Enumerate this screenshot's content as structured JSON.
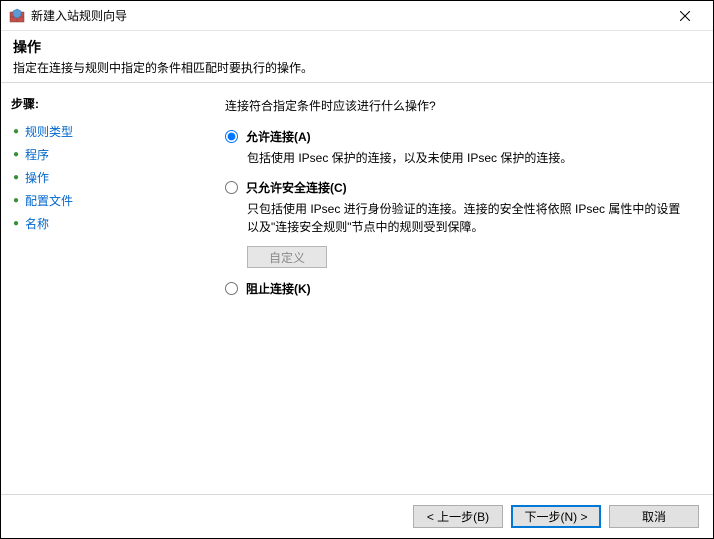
{
  "titlebar": {
    "title": "新建入站规则向导"
  },
  "header": {
    "title": "操作",
    "desc": "指定在连接与规则中指定的条件相匹配时要执行的操作。"
  },
  "sidebar": {
    "steps_label": "步骤:",
    "items": [
      {
        "label": "规则类型"
      },
      {
        "label": "程序"
      },
      {
        "label": "操作"
      },
      {
        "label": "配置文件"
      },
      {
        "label": "名称"
      }
    ]
  },
  "content": {
    "question": "连接符合指定条件时应该进行什么操作?",
    "options": [
      {
        "id": "allow",
        "label": "允许连接(A)",
        "desc": "包括使用 IPsec 保护的连接，以及未使用 IPsec 保护的连接。",
        "checked": true
      },
      {
        "id": "allow_secure",
        "label": "只允许安全连接(C)",
        "desc": "只包括使用 IPsec 进行身份验证的连接。连接的安全性将依照 IPsec 属性中的设置以及\"连接安全规则\"节点中的规则受到保障。",
        "checked": false
      },
      {
        "id": "block",
        "label": "阻止连接(K)",
        "desc": "",
        "checked": false
      }
    ],
    "customize_label": "自定义"
  },
  "footer": {
    "back": "< 上一步(B)",
    "next": "下一步(N) >",
    "cancel": "取消"
  }
}
